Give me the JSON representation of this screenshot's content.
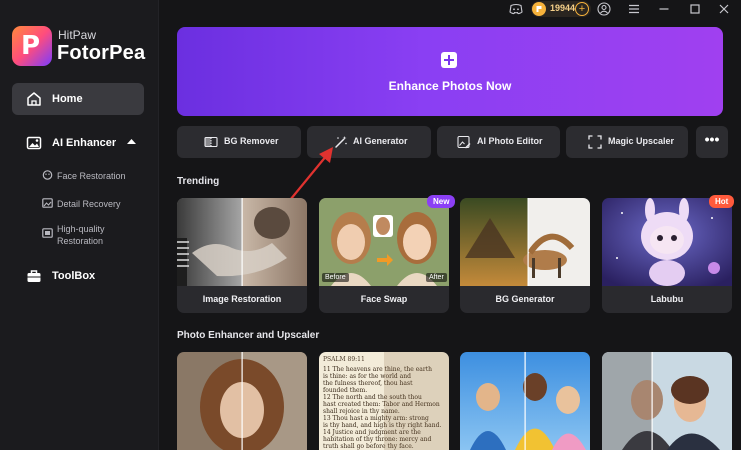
{
  "app": {
    "brand_top": "HitPaw",
    "brand_name": "FotorPea",
    "logo_letter": "P"
  },
  "colors": {
    "accent": "#7a36ee",
    "coin": "#f6b23b",
    "new_badge": "#8b3ff5",
    "hot_badge": "#ff5a3c",
    "arrow": "#e0322f"
  },
  "topbar": {
    "coins": "19944",
    "coin_plus": "+"
  },
  "sidebar": {
    "home": "Home",
    "ai_enhancer": "AI Enhancer",
    "sub_items": [
      "Face Restoration",
      "Detail Recovery",
      "High-quality Restoration"
    ],
    "toolbox": "ToolBox"
  },
  "hero": {
    "label": "Enhance Photos Now"
  },
  "tools": [
    {
      "label": "BG Remover",
      "icon": "bg-remover-icon"
    },
    {
      "label": "AI Generator",
      "icon": "magic-wand-icon"
    },
    {
      "label": "AI Photo Editor",
      "icon": "photo-edit-icon"
    },
    {
      "label": "Magic Upscaler",
      "icon": "upscale-icon"
    }
  ],
  "more": "•••",
  "trending": {
    "title": "Trending",
    "cards": [
      {
        "label": "Image Restoration"
      },
      {
        "label": "Face Swap",
        "badge": "New",
        "before": "Before",
        "after": "After"
      },
      {
        "label": "BG Generator"
      },
      {
        "label": "Labubu",
        "badge": "Hot"
      }
    ]
  },
  "enhancer": {
    "title": "Photo Enhancer and Upscaler",
    "psalm": {
      "head": "PSALM 89:11",
      "lines": [
        "11 The heavens are thine, the earth",
        "is thine: as for the world and",
        "the fulness thereof, thou hast",
        "founded them.",
        "12 The north and the south thou",
        "hast created them: Tabor and Hermon",
        "shall rejoice in thy name.",
        "13 Thou hast a mighty arm: strong",
        "is thy hand, and high is thy right hand.",
        "14 Justice and judgment are the",
        "habitation of thy throne: mercy and",
        "truth shall go before thy face."
      ]
    }
  }
}
